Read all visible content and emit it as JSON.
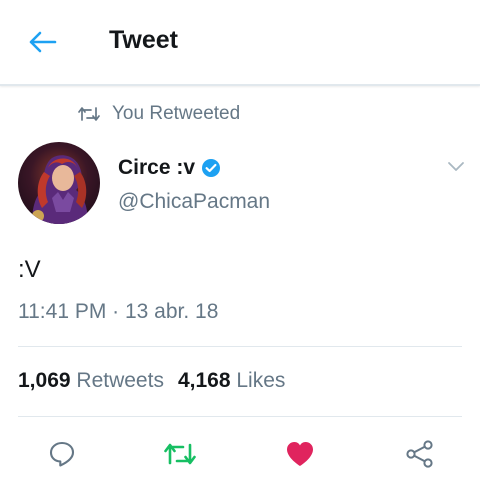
{
  "header": {
    "title": "Tweet",
    "back_icon": "arrow-left-icon"
  },
  "retweet_context": {
    "text": "You Retweeted",
    "icon": "retweet-icon"
  },
  "author": {
    "name": "Circe :v",
    "handle": "@ChicaPacman",
    "verified": true,
    "verified_icon": "verified-badge-icon"
  },
  "tweet": {
    "text": ":V",
    "timestamp": "11:41 PM · 13 abr. 18"
  },
  "stats": {
    "retweets_count": "1,069",
    "retweets_label": "Retweets",
    "likes_count": "4,168",
    "likes_label": "Likes"
  },
  "actions": {
    "reply_icon": "reply-icon",
    "retweet_icon": "retweet-icon",
    "like_icon": "heart-icon",
    "share_icon": "share-icon"
  },
  "colors": {
    "accent": "#1da1f2",
    "retweet_green": "#17bf63",
    "like_red": "#e0245e",
    "secondary_text": "#657786"
  }
}
